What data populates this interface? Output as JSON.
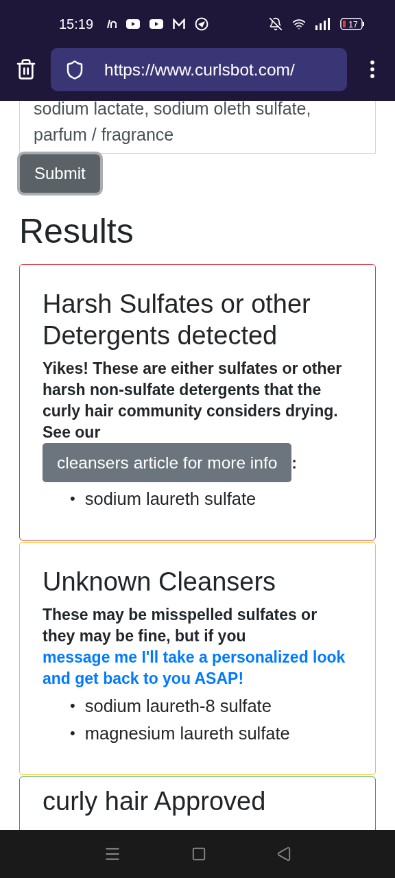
{
  "status_bar": {
    "time": "15:19",
    "battery": "17"
  },
  "browser": {
    "url": "https://www.curlsbot.com/"
  },
  "ingredients_field": {
    "lines": [
      "sodium lactate, sodium oleth sulfate,",
      "parfum / fragrance"
    ]
  },
  "submit_button": "Submit",
  "results_heading": "Results",
  "result_cards": [
    {
      "kind": "harsh",
      "color": "#dc3545",
      "title": "Harsh Sulfates or other Detergents detected",
      "text": "Yikes! These are either sulfates or other harsh non-sulfate detergents that the curly hair community considers drying. See our",
      "button": "cleansers article for more info",
      "after": ":",
      "bullet": "•",
      "ingredients": [
        "sodium laureth sulfate"
      ]
    },
    {
      "kind": "unknown",
      "color": "#ffc107",
      "title": "Unknown Cleansers",
      "text": "These may be misspelled sulfates or they may be fine, but if you",
      "link": "message me I'll take a personalized look and get back to you ASAP!",
      "bullet": "•",
      "ingredients": [
        "sodium laureth-8 sulfate",
        "magnesium laureth sulfate"
      ]
    },
    {
      "kind": "approved",
      "color": "#28a745",
      "title": "curly hair Approved"
    }
  ]
}
